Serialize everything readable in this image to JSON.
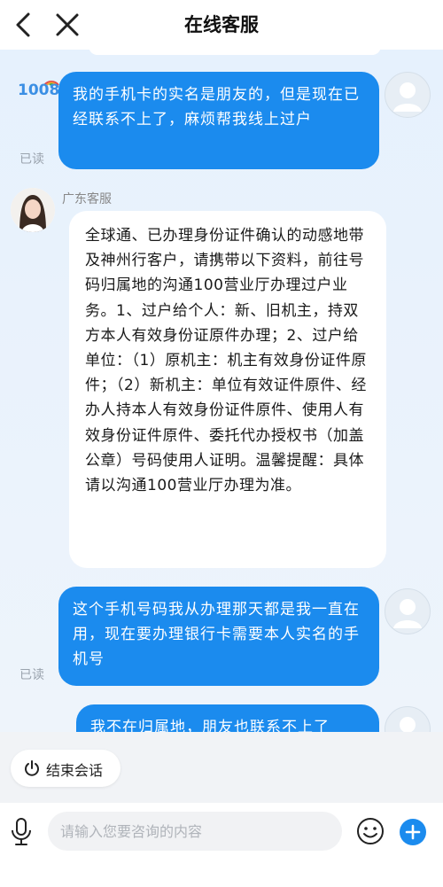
{
  "header": {
    "title": "在线客服"
  },
  "brand_text": "1008",
  "messages": [
    {
      "side": "user",
      "text": "我的手机卡的实名是朋友的，但是现在已经联系不上了，麻烦帮我线上过户",
      "status": "已读"
    },
    {
      "side": "agent",
      "name": "广东客服",
      "text": "全球通、已办理身份证件确认的动感地带及神州行客户，请携带以下资料，前往号码归属地的沟通100营业厅办理过户业务。1、过户给个人：新、旧机主，持双方本人有效身份证原件办理；2、过户给单位：（1）原机主：机主有效身份证件原件；（2）新机主：单位有效证件原件、经办人持本人有效身份证件原件、使用人有效身份证件原件、委托代办授权书（加盖公章）号码使用人证明。温馨提醒：具体请以沟通100营业厅办理为准。"
    },
    {
      "side": "user",
      "text": "这个手机号码我从办理那天都是我一直在用，现在要办理银行卡需要本人实名的手机号",
      "status": "已读"
    },
    {
      "side": "user",
      "text": "我不在归属地，朋友也联系不上了"
    }
  ],
  "end_session_label": "结束会话",
  "input": {
    "placeholder": "请输入您要咨询的内容"
  },
  "colors": {
    "accent": "#1b8bee",
    "background": "#eaf2fd"
  },
  "icons": [
    "back-arrow-icon",
    "close-icon",
    "power-icon",
    "microphone-icon",
    "emoji-icon",
    "plus-icon"
  ]
}
